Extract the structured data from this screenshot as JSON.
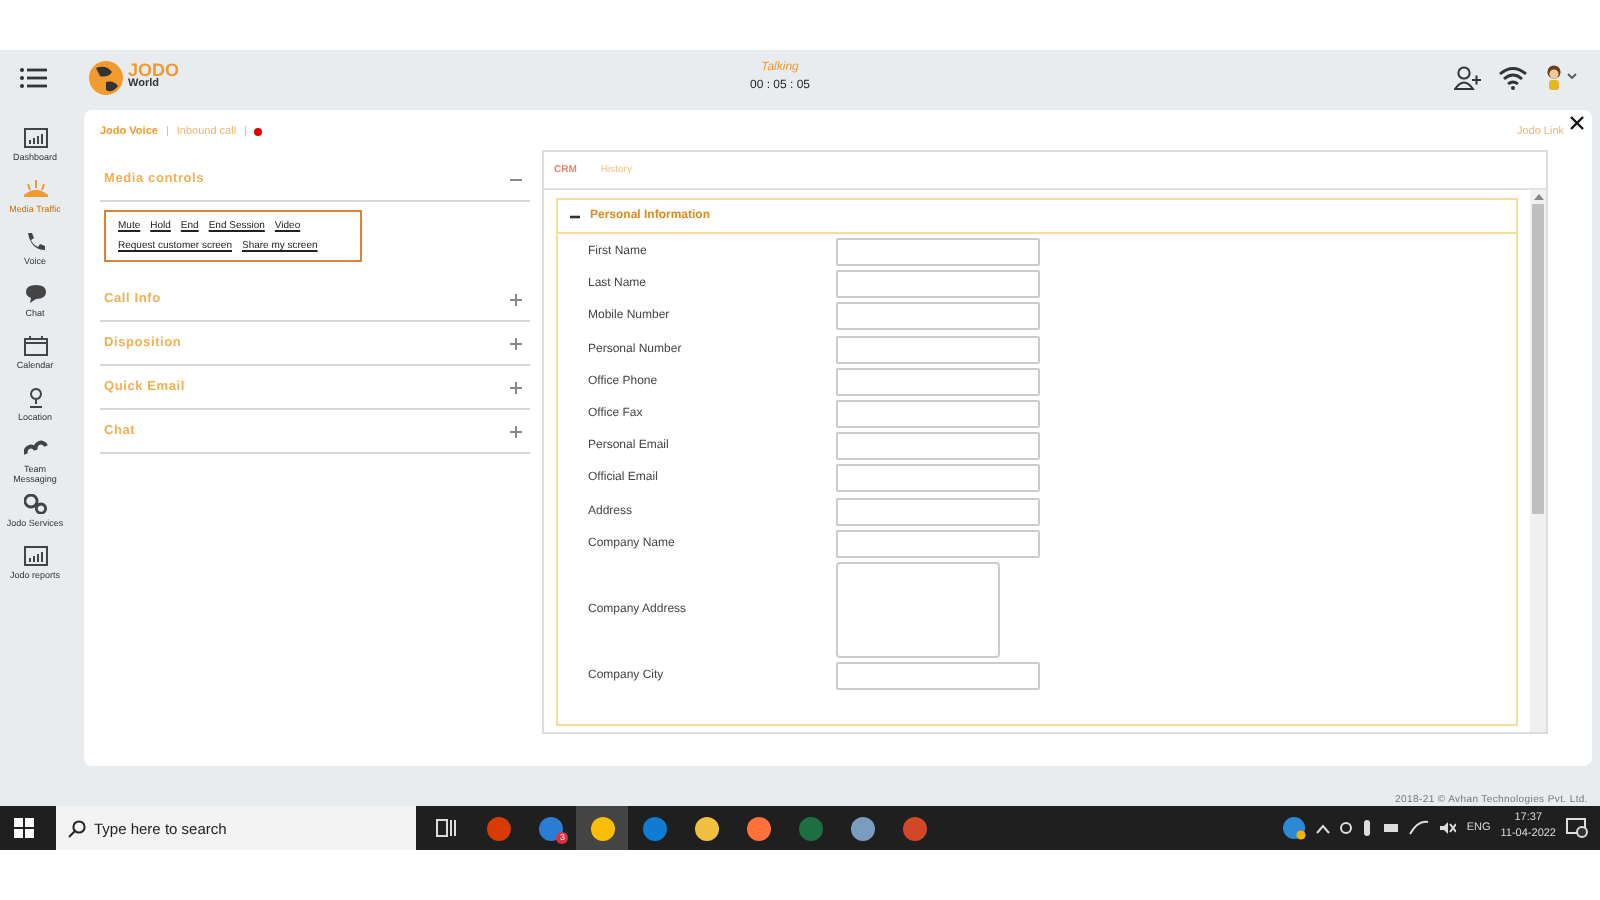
{
  "header": {
    "logo_title": "JODO",
    "logo_subtitle": "World",
    "call_status": "Talking",
    "timer": "00 : 05 : 05"
  },
  "sidebar": {
    "items": [
      {
        "label": "Dashboard",
        "selected": false
      },
      {
        "label": "Media Traffic",
        "selected": true
      },
      {
        "label": "Voice",
        "selected": false
      },
      {
        "label": "Chat",
        "selected": false
      },
      {
        "label": "Calendar",
        "selected": false
      },
      {
        "label": "Location",
        "selected": false
      },
      {
        "label": "Team Messaging",
        "selected": false
      },
      {
        "label": "Jodo Services",
        "selected": false
      },
      {
        "label": "Jodo reports",
        "selected": false
      }
    ]
  },
  "breadcrumb": {
    "items": [
      "Jodo Voice",
      "Inbound call"
    ],
    "separator": "|",
    "recording": true
  },
  "jodo_link": "Jodo Link",
  "panels": [
    {
      "title": "Media controls",
      "expanded": true,
      "actions": [
        "Mute",
        "Hold",
        "End",
        "End Session",
        "Video",
        "Request customer screen",
        "Share my screen"
      ]
    },
    {
      "title": "Call Info",
      "expanded": false
    },
    {
      "title": "Disposition",
      "expanded": false
    },
    {
      "title": "Quick Email",
      "expanded": false
    },
    {
      "title": "Chat",
      "expanded": false
    }
  ],
  "crm": {
    "tabs": [
      {
        "label": "CRM",
        "selected": true
      },
      {
        "label": "History",
        "selected": false
      }
    ],
    "section": {
      "title": "Personal Information",
      "expanded": true
    },
    "fields": [
      {
        "label": "First Name",
        "kind": "text"
      },
      {
        "label": "Last Name",
        "kind": "text"
      },
      {
        "label": "Mobile Number",
        "kind": "text"
      },
      {
        "label": "Personal Number",
        "kind": "text"
      },
      {
        "label": "Office Phone",
        "kind": "text"
      },
      {
        "label": "Office Fax",
        "kind": "text"
      },
      {
        "label": "Personal Email",
        "kind": "text"
      },
      {
        "label": "Official Email",
        "kind": "text"
      },
      {
        "label": "Address",
        "kind": "text"
      },
      {
        "label": "Company Name",
        "kind": "text"
      },
      {
        "label": "Company Address",
        "kind": "textarea"
      },
      {
        "label": "Company City",
        "kind": "text"
      }
    ]
  },
  "copyright": "2018-21 © Avhan Technologies Pvt. Ltd.",
  "taskbar": {
    "search_placeholder": "Type here to search",
    "mail_badge": "3",
    "language": "ENG",
    "time": "17:37",
    "date": "11-04-2022"
  }
}
